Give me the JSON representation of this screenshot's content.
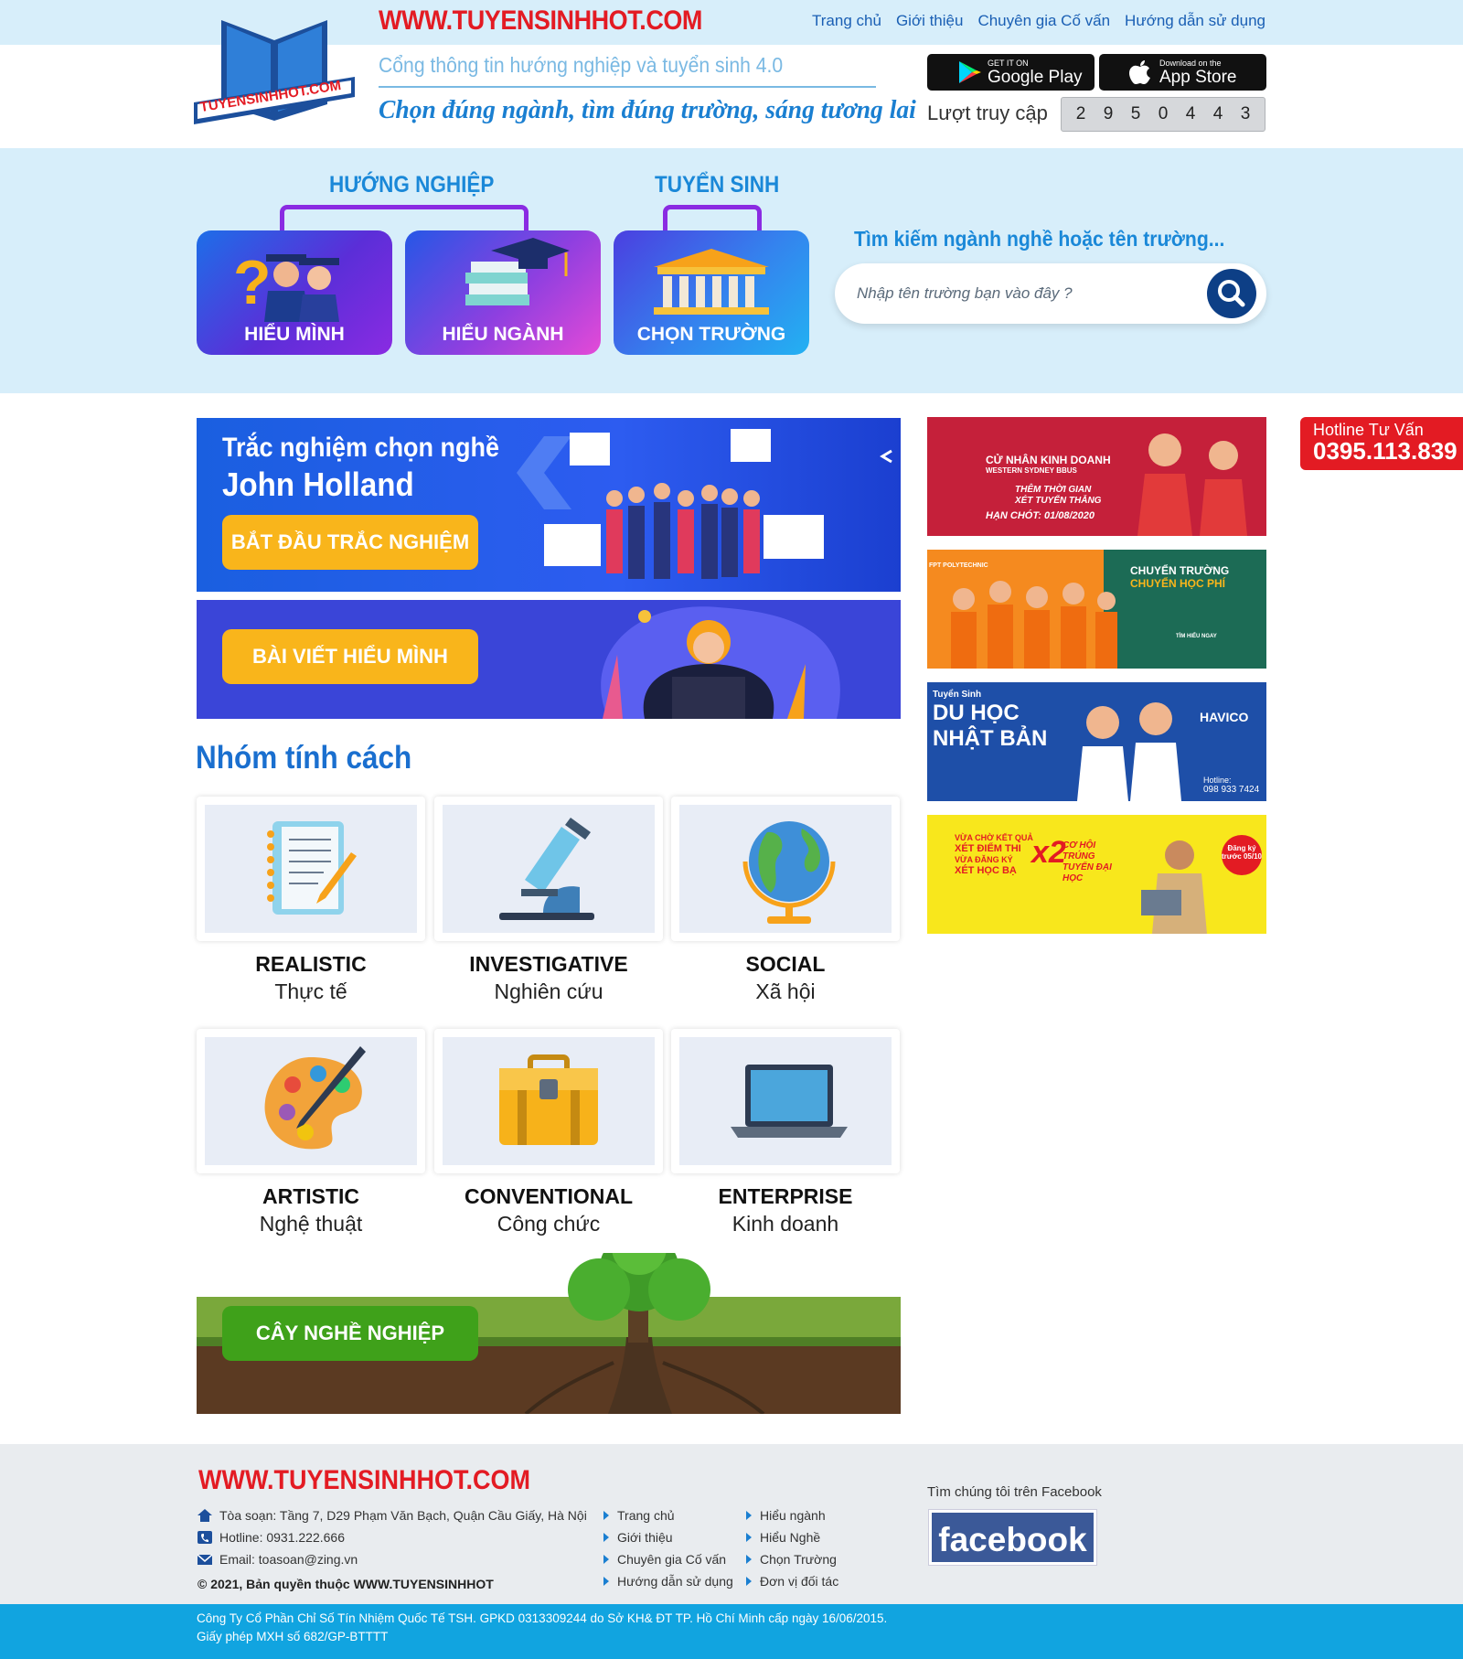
{
  "header": {
    "site_url": "WWW.TUYENSINHHOT.COM",
    "nav": [
      "Trang chủ",
      "Giới thiệu",
      "Chuyên gia Cố vấn",
      "Hướng dẫn sử dụng"
    ],
    "logo_text": "TUYENSINHHOT.COM",
    "tagline1": "Cổng thông tin hướng nghiệp và tuyển sinh 4.0",
    "tagline2": "Chọn đúng ngành, tìm đúng trường, sáng tương lai",
    "google_play": {
      "small": "GET IT ON",
      "big": "Google Play"
    },
    "app_store": {
      "small": "Download on the",
      "big": "App Store"
    },
    "visits_label": "Lượt truy cập",
    "visit_digits": [
      "2",
      "9",
      "5",
      "0",
      "4",
      "4",
      "3"
    ]
  },
  "hero": {
    "group1": "HƯỚNG NGHIỆP",
    "group2": "TUYỂN SINH",
    "cards": [
      "HIỂU MÌNH",
      "HIỂU NGÀNH",
      "CHỌN TRƯỜNG"
    ],
    "search_title": "Tìm kiếm ngành nghề hoặc tên trường...",
    "search_placeholder": "Nhập tên trường bạn vào đây ?"
  },
  "banners": {
    "holland_line1": "Trắc nghiệm chọn nghề",
    "holland_line2": "John Holland",
    "holland_button": "BẮT ĐẦU TRẮC NGHIỆM",
    "article_button": "BÀI VIẾT HIỂU MÌNH",
    "tree_button": "CÂY NGHỀ NGHIỆP"
  },
  "personality": {
    "title": "Nhóm tính cách",
    "groups": [
      {
        "en": "REALISTIC",
        "vi": "Thực tế"
      },
      {
        "en": "INVESTIGATIVE",
        "vi": "Nghiên cứu"
      },
      {
        "en": "SOCIAL",
        "vi": "Xã hội"
      },
      {
        "en": "ARTISTIC",
        "vi": "Nghệ thuật"
      },
      {
        "en": "CONVENTIONAL",
        "vi": "Công chức"
      },
      {
        "en": "ENTERPRISE",
        "vi": "Kinh doanh"
      }
    ]
  },
  "ads": {
    "ad1": {
      "line1": "CỬ NHÂN KINH DOANH",
      "line2": "WESTERN SYDNEY BBUS",
      "line3": "THÊM THỜI GIAN",
      "line4": "XÉT TUYỂN THẲNG",
      "line5": "HẠN CHÓT: 01/08/2020"
    },
    "ad2": {
      "line1": "FPT POLYTECHNIC",
      "line2": "CHUYỂN TRƯỜNG",
      "line3": "CHUYỂN HỌC PHÍ",
      "line4": "TÌM HIỂU NGAY"
    },
    "ad3": {
      "line1": "Tuyển Sinh",
      "line2": "DU HỌC",
      "line3": "NHẬT BẢN",
      "line4": "HAVICO",
      "line5": "Hotline:",
      "line6": "098 933 7424"
    },
    "ad4": {
      "line1": "VỪA CHỜ KẾT QUẢ",
      "line2": "XÉT ĐIỂM THI",
      "line3": "VỪA ĐĂNG KÝ",
      "line4": "XÉT HỌC BẠ",
      "line5": "x2",
      "line6": "CƠ HỘI TRÚNG TUYỂN ĐẠI HỌC",
      "line7": "Đăng ký trước 05/10"
    }
  },
  "hotline": {
    "label": "Hotline Tư Vấn",
    "number": "0395.113.839"
  },
  "footer": {
    "site_url": "WWW.TUYENSINHHOT.COM",
    "address": "Tòa soạn: Tầng 7, D29 Phạm Văn Bạch, Quận Cầu Giấy, Hà Nội",
    "hotline": "Hotline: 0931.222.666",
    "email": "Email: toasoan@zing.vn",
    "copyright": "© 2021, Bản quyền thuộc WWW.TUYENSINHHOT",
    "links_col1": [
      "Trang chủ",
      "Giới thiệu",
      "Chuyên gia Cố vấn",
      "Hướng dẫn sử dụng"
    ],
    "links_col2": [
      "Hiểu ngành",
      "Hiểu Nghề",
      "Chọn Trường",
      "Đơn vị đối tác"
    ],
    "fb_label": "Tìm chúng tôi trên Facebook",
    "fb_button": "facebook",
    "company1": "Công Ty Cổ Phần Chỉ Số Tín Nhiệm Quốc Tế TSH. GPKD 0313309244 do Sở KH& ĐT TP. Hồ Chí Minh cấp ngày 16/06/2015.",
    "company2": "Giấy phép MXH số 682/GP-BTTTT"
  },
  "colors": {
    "brand_red": "#e31b23",
    "brand_blue": "#1a88d8",
    "light_bg": "#d7eefa",
    "button_yellow": "#f9b51b"
  }
}
